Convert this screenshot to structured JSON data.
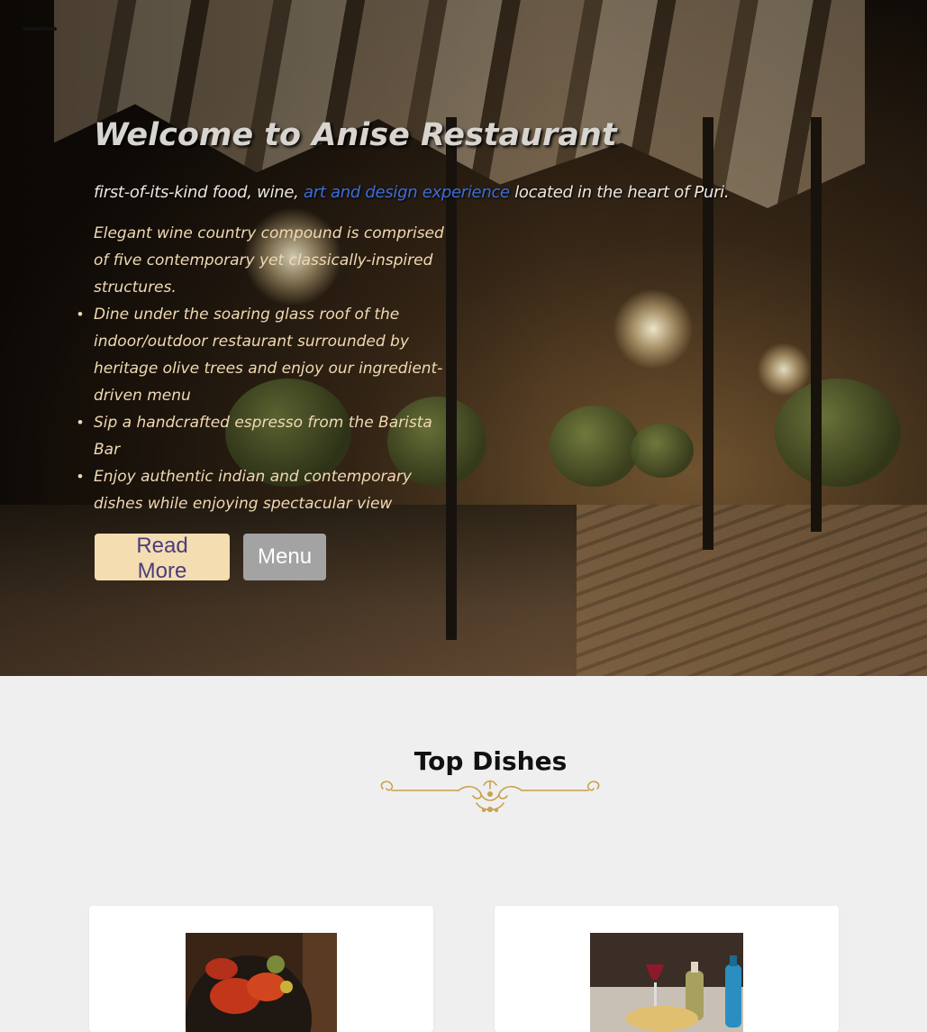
{
  "nav": {
    "menu_icon": "hamburger-icon"
  },
  "hero": {
    "title": "Welcome to Anise Restaurant",
    "tagline_start": "first-of-its-kind food, wine, ",
    "tagline_link": "art and design experience",
    "tagline_end": " located in the heart of Puri.",
    "intro": "Elegant wine country compound is comprised of five contemporary yet classically-inspired structures.",
    "bullets": [
      "Dine under the soaring glass roof of the indoor/outdoor restaurant surrounded by heritage olive trees and enjoy our ingredient-driven menu",
      "Sip a handcrafted espresso from the Barista Bar",
      "Enjoy authentic indian and contemporary dishes while enjoying spectacular view"
    ],
    "read_more_label": "Read More",
    "menu_label": "Menu"
  },
  "top_dishes": {
    "title": "Top Dishes",
    "ornament_icon": "gold-flourish-divider-icon"
  },
  "colors": {
    "read_more_bg": "#f4ddb1",
    "read_more_text": "#4c3d7c",
    "menu_bg": "#a3a3a3",
    "tagline_link": "#3c6ed8",
    "hero_text": "#f0d9b2",
    "ornament_gold": "#c9a24a",
    "section_bg": "#efefef"
  }
}
